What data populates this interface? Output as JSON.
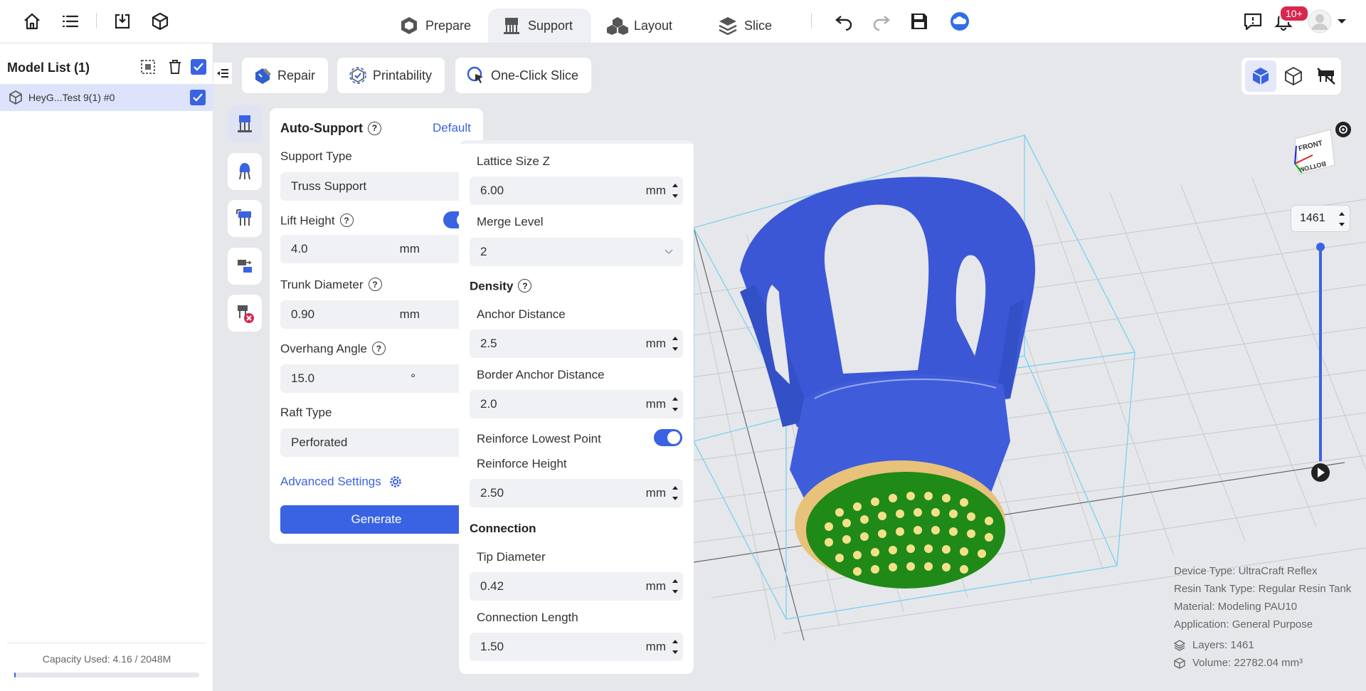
{
  "tabs": {
    "prepare": "Prepare",
    "support": "Support",
    "layout": "Layout",
    "slice": "Slice"
  },
  "notifications": {
    "badge": "10+"
  },
  "sidebar": {
    "title": "Model List (1)",
    "model_name": "HeyG...Test 9(1) #0",
    "capacity": "Capacity Used: 4.16 / 2048M",
    "capacity_fraction": 0.002
  },
  "toolbar": {
    "repair": "Repair",
    "printability": "Printability",
    "one_click_slice": "One-Click Slice"
  },
  "auto_support": {
    "title": "Auto-Support",
    "preset": "Default",
    "support_type_label": "Support Type",
    "support_type_value": "Truss Support",
    "lift_height_label": "Lift Height",
    "lift_height_value": "4.0",
    "trunk_diameter_label": "Trunk Diameter",
    "trunk_diameter_value": "0.90",
    "overhang_angle_label": "Overhang Angle",
    "overhang_angle_value": "15.0",
    "raft_type_label": "Raft Type",
    "raft_type_value": "Perforated",
    "advanced_settings": "Advanced Settings",
    "generate": "Generate",
    "unit_mm": "mm",
    "unit_deg": "°"
  },
  "advanced": {
    "lattice_size_z_label": "Lattice Size Z",
    "lattice_size_z_value": "6.00",
    "merge_level_label": "Merge Level",
    "merge_level_value": "2",
    "density_title": "Density",
    "anchor_distance_label": "Anchor Distance",
    "anchor_distance_value": "2.5",
    "border_anchor_distance_label": "Border Anchor Distance",
    "border_anchor_distance_value": "2.0",
    "reinforce_lowest_point_label": "Reinforce Lowest Point",
    "reinforce_height_label": "Reinforce Height",
    "reinforce_height_value": "2.50",
    "connection_title": "Connection",
    "tip_diameter_label": "Tip Diameter",
    "tip_diameter_value": "0.42",
    "connection_length_label": "Connection Length",
    "connection_length_value": "1.50",
    "unit_mm": "mm"
  },
  "viewport": {
    "layer_value": "1461",
    "cube_front": "FRONT",
    "cube_bottom": "BOTTOM",
    "device_type": "Device Type:  UltraCraft Reflex",
    "resin_tank_type": "Resin Tank Type:  Regular Resin Tank",
    "material": "Material:  Modeling PAU10",
    "application": "Application:  General Purpose",
    "layers": "Layers: 1461",
    "volume": "Volume: 22782.04 mm³"
  },
  "colors": {
    "accent": "#3a63e3",
    "model_blue": "#3b57d6",
    "raft_green": "#1f8a18",
    "support_tan": "#e8c27a"
  }
}
